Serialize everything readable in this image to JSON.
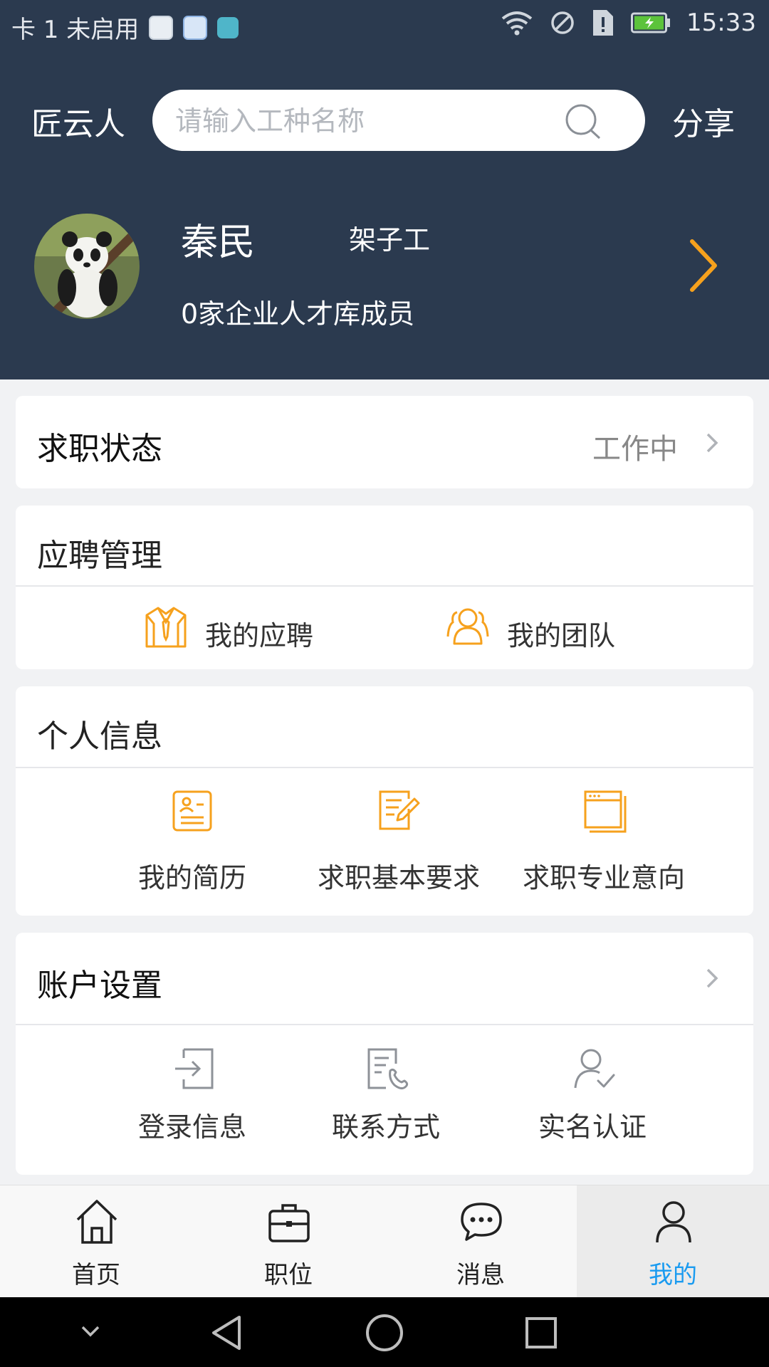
{
  "status_bar": {
    "carrier": "卡 1 未启用",
    "time": "15:33"
  },
  "header": {
    "app_title": "匠云人",
    "search_placeholder": "请输入工种名称",
    "share_label": "分享"
  },
  "profile": {
    "name": "秦民",
    "trade": "架子工",
    "talent_pool": "0家企业人才库成员"
  },
  "job_status": {
    "title": "求职状态",
    "value": "工作中"
  },
  "application_mgmt": {
    "title": "应聘管理",
    "items": [
      {
        "label": "我的应聘",
        "icon": "shirt-tie-icon"
      },
      {
        "label": "我的团队",
        "icon": "team-icon"
      }
    ]
  },
  "personal_info": {
    "title": "个人信息",
    "items": [
      {
        "label": "我的简历",
        "icon": "resume-icon"
      },
      {
        "label": "求职基本要求",
        "icon": "edit-document-icon"
      },
      {
        "label": "求职专业意向",
        "icon": "window-icon"
      }
    ]
  },
  "account_settings": {
    "title": "账户设置",
    "items": [
      {
        "label": "登录信息",
        "icon": "login-icon"
      },
      {
        "label": "联系方式",
        "icon": "contact-phone-icon"
      },
      {
        "label": "实名认证",
        "icon": "verified-user-icon"
      }
    ]
  },
  "bottom_nav": {
    "tabs": [
      {
        "label": "首页",
        "icon": "home-icon"
      },
      {
        "label": "职位",
        "icon": "briefcase-icon"
      },
      {
        "label": "消息",
        "icon": "message-icon"
      },
      {
        "label": "我的",
        "icon": "person-icon",
        "active": true
      }
    ]
  },
  "colors": {
    "header_bg": "#2b3a4f",
    "accent_orange": "#f6a11d",
    "active_tab": "#1a9bf0"
  }
}
